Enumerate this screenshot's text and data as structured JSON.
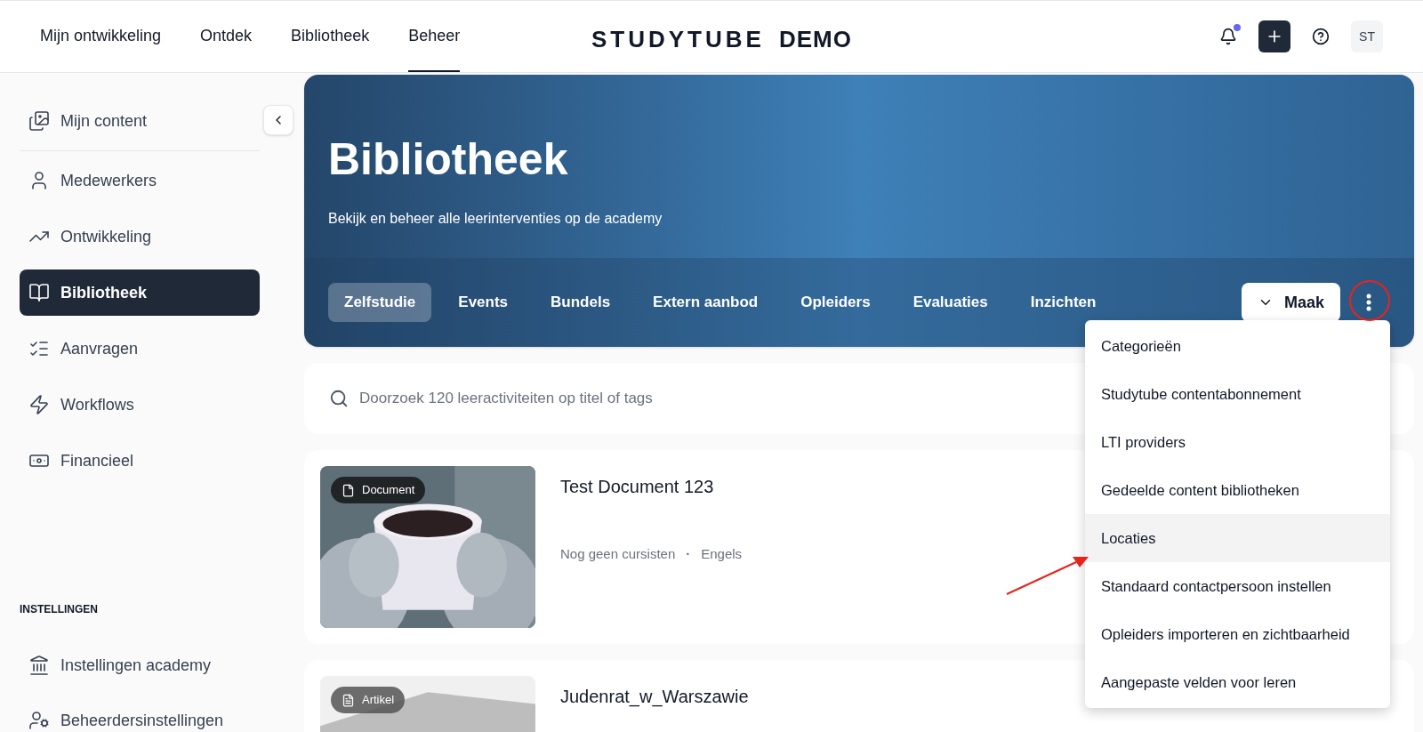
{
  "top_nav": {
    "items": [
      {
        "label": "Mijn ontwikkeling",
        "selected": false
      },
      {
        "label": "Ontdek",
        "selected": false
      },
      {
        "label": "Bibliotheek",
        "selected": false
      },
      {
        "label": "Beheer",
        "selected": true
      }
    ],
    "logo": {
      "brand": "STUDYTUBE",
      "suffix": "DEMO"
    },
    "notification_unread": true,
    "avatar": "ST"
  },
  "sidebar": {
    "items": [
      {
        "label": "Mijn content",
        "kind": "images",
        "selected": false
      },
      {
        "label": "Medewerkers",
        "kind": "user",
        "selected": false
      },
      {
        "label": "Ontwikkeling",
        "kind": "trend",
        "selected": false
      },
      {
        "label": "Bibliotheek",
        "kind": "book",
        "selected": true
      },
      {
        "label": "Aanvragen",
        "kind": "checklist",
        "selected": false
      },
      {
        "label": "Workflows",
        "kind": "bolt",
        "selected": false
      },
      {
        "label": "Financieel",
        "kind": "money",
        "selected": false
      }
    ],
    "settings_heading": "INSTELLINGEN",
    "settings_items": [
      {
        "label": "Instellingen academy",
        "kind": "bank",
        "selected": false
      },
      {
        "label": "Beheerdersinstellingen",
        "kind": "usercog",
        "selected": false
      }
    ]
  },
  "hero": {
    "title": "Bibliotheek",
    "subtitle": "Bekijk en beheer alle leerinterventies op de academy",
    "tabs": [
      {
        "label": "Zelfstudie",
        "selected": true
      },
      {
        "label": "Events",
        "selected": false
      },
      {
        "label": "Bundels",
        "selected": false
      },
      {
        "label": "Extern aanbod",
        "selected": false
      },
      {
        "label": "Opleiders",
        "selected": false
      },
      {
        "label": "Evaluaties",
        "selected": false
      },
      {
        "label": "Inzichten",
        "selected": false
      }
    ],
    "create_button": "Maak"
  },
  "search": {
    "placeholder": "Doorzoek 120 leeractiviteiten op titel of tags"
  },
  "items": [
    {
      "title": "Test Document 123",
      "badge": "Document",
      "kind": "document",
      "meta": [
        "Nog geen cursisten",
        "Engels"
      ],
      "meta_separator": "·"
    },
    {
      "title": "Judenrat_w_Warszawie",
      "badge": "Artikel",
      "kind": "article"
    }
  ],
  "menu": {
    "items": [
      {
        "label": "Categorieën",
        "highlighted": false
      },
      {
        "label": "Studytube contentabonnement",
        "highlighted": false
      },
      {
        "label": "LTI providers",
        "highlighted": false
      },
      {
        "label": "Gedeelde content bibliotheken",
        "highlighted": false
      },
      {
        "label": "Locaties",
        "highlighted": true
      },
      {
        "label": "Standaard contactpersoon instellen",
        "highlighted": false
      },
      {
        "label": "Opleiders importeren en zichtbaarheid",
        "highlighted": false
      },
      {
        "label": "Aangepaste velden voor leren",
        "highlighted": false
      }
    ]
  }
}
